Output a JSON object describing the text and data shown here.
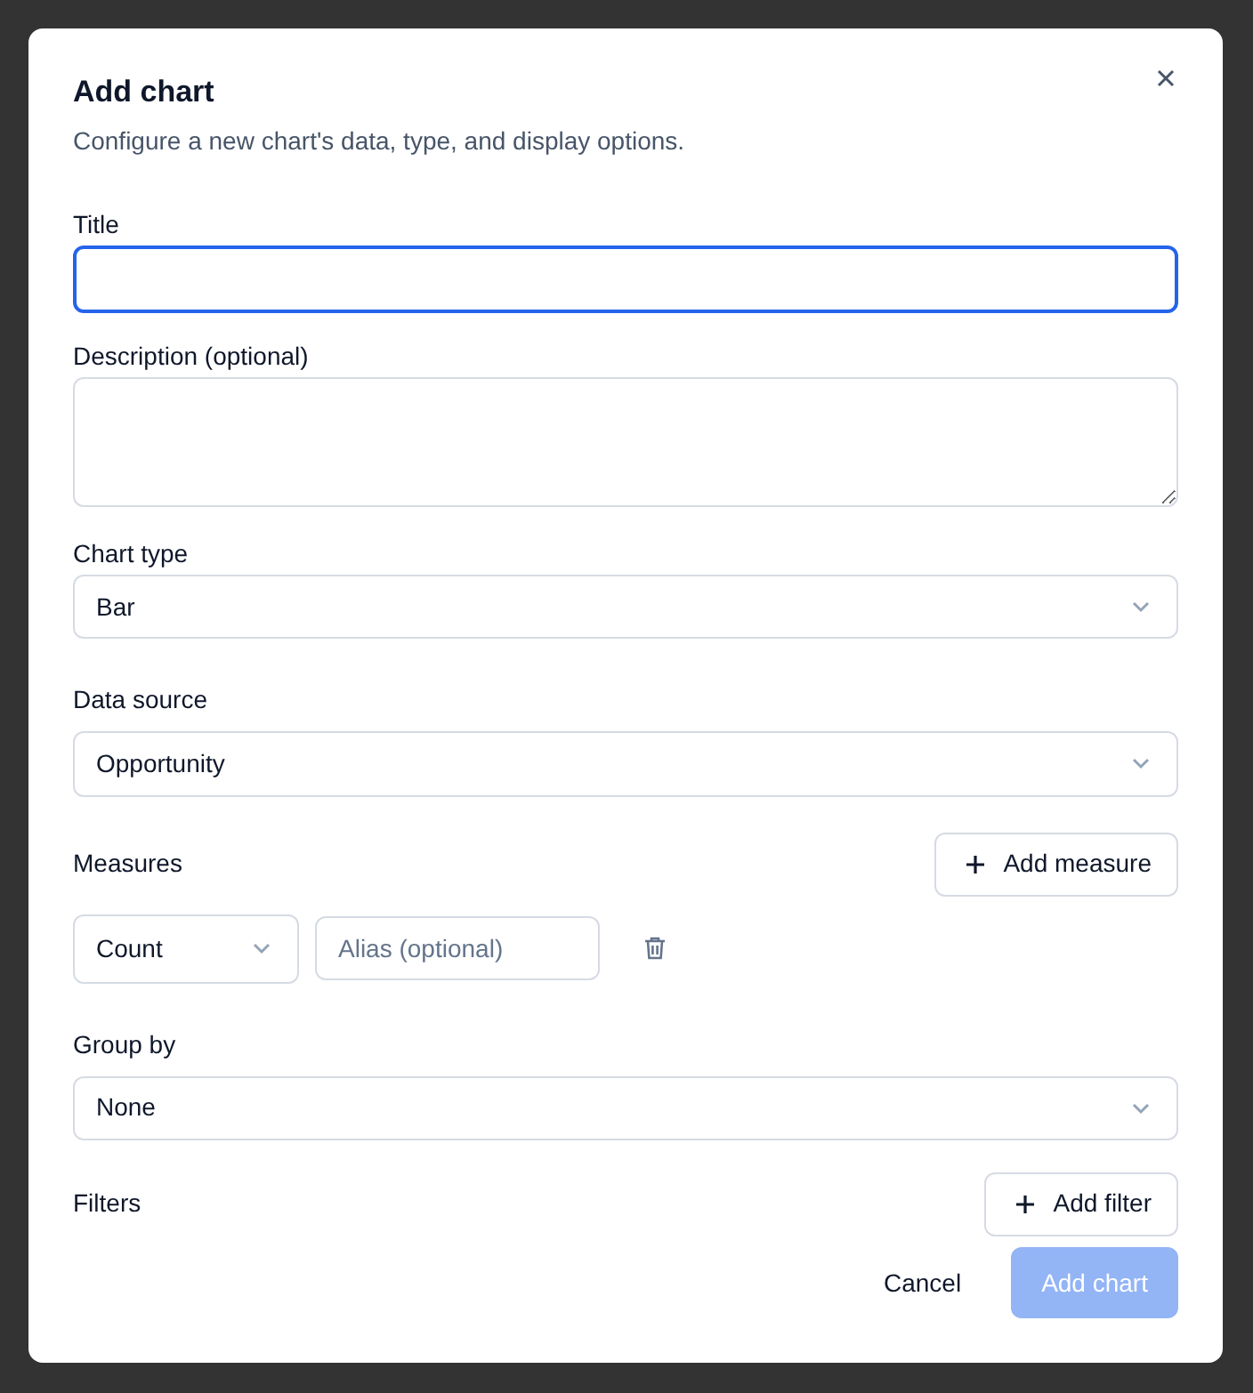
{
  "dialog": {
    "title": "Add chart",
    "subtitle": "Configure a new chart's data, type, and display options.",
    "title_field": {
      "label": "Title",
      "focused": true
    },
    "description_field": {
      "label": "Description (optional)"
    },
    "chart_type": {
      "label": "Chart type",
      "value": "Bar"
    },
    "data_source": {
      "label": "Data source",
      "value": "Opportunity"
    },
    "measures": {
      "label": "Measures",
      "add_button": "Add measure",
      "rows": [
        {
          "aggregate": "Count",
          "alias_placeholder": "Alias (optional)"
        }
      ]
    },
    "group_by": {
      "label": "Group by",
      "value": "None"
    },
    "filters": {
      "label": "Filters",
      "add_button": "Add filter"
    },
    "buttons": {
      "cancel": "Cancel",
      "submit": {
        "label": "Add chart",
        "disabled": true
      }
    }
  }
}
